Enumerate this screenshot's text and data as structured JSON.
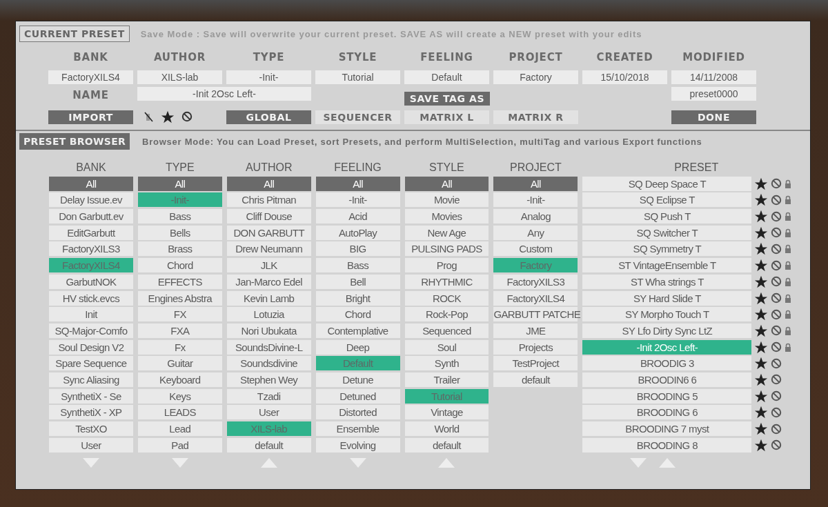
{
  "current_preset": {
    "title": "CURRENT PRESET",
    "save_mode_text": "Save Mode : Save will overwrite your current preset. SAVE AS will create a NEW preset with your edits",
    "fields": [
      {
        "label": "BANK",
        "value": "FactoryXILS4"
      },
      {
        "label": "AUTHOR",
        "value": "XILS-lab"
      },
      {
        "label": "TYPE",
        "value": "-Init-"
      },
      {
        "label": "STYLE",
        "value": "Tutorial"
      },
      {
        "label": "FEELING",
        "value": "Default"
      },
      {
        "label": "PROJECT",
        "value": "Factory"
      },
      {
        "label": "CREATED",
        "value": "15/10/2018"
      },
      {
        "label": "MODIFIED",
        "value": "14/11/2008"
      }
    ],
    "name": {
      "label": "NAME",
      "value": "-Init 2Osc Left-"
    },
    "save_tag_button": "SAVE TAG AS",
    "file_name": "preset0000",
    "import_button": "IMPORT",
    "tabs": [
      {
        "label": "GLOBAL",
        "selected": true
      },
      {
        "label": "SEQUENCER",
        "selected": false
      },
      {
        "label": "MATRIX L",
        "selected": false
      },
      {
        "label": "MATRIX R",
        "selected": false
      }
    ],
    "done_button": "DONE"
  },
  "preset_browser": {
    "title": "PRESET BROWSER",
    "mode_text": "Browser Mode: You can Load Preset, sort Presets, and perform MultiSelection, multiTag and various Export functions",
    "columns": [
      {
        "heading": "BANK",
        "all_label": "All",
        "scroll_down": true,
        "items": [
          {
            "label": "Delay Issue.ev",
            "selected": false
          },
          {
            "label": "Don Garbutt.ev",
            "selected": false
          },
          {
            "label": "EditGarbutt",
            "selected": false
          },
          {
            "label": "FactoryXILS3",
            "selected": false
          },
          {
            "label": "FactoryXILS4",
            "selected": true
          },
          {
            "label": "GarbutNOK",
            "selected": false
          },
          {
            "label": "HV stick.evcs",
            "selected": false
          },
          {
            "label": "Init",
            "selected": false
          },
          {
            "label": "SQ-Major-Comfo",
            "selected": false
          },
          {
            "label": "Soul Design V2",
            "selected": false
          },
          {
            "label": "Spare Sequence",
            "selected": false
          },
          {
            "label": "Sync Aliasing",
            "selected": false
          },
          {
            "label": "SynthetiX - Se",
            "selected": false
          },
          {
            "label": "SynthetiX - XP",
            "selected": false
          },
          {
            "label": "TestXO",
            "selected": false
          },
          {
            "label": "User",
            "selected": false
          }
        ]
      },
      {
        "heading": "TYPE",
        "all_label": "All",
        "scroll_down": true,
        "items": [
          {
            "label": "-Init-",
            "selected": true
          },
          {
            "label": "Bass",
            "selected": false
          },
          {
            "label": "Bells",
            "selected": false
          },
          {
            "label": "Brass",
            "selected": false
          },
          {
            "label": "Chord",
            "selected": false
          },
          {
            "label": "EFFECTS",
            "selected": false
          },
          {
            "label": "Engines Abstra",
            "selected": false
          },
          {
            "label": "FX",
            "selected": false
          },
          {
            "label": "FXA",
            "selected": false
          },
          {
            "label": "Fx",
            "selected": false
          },
          {
            "label": "Guitar",
            "selected": false
          },
          {
            "label": "Keyboard",
            "selected": false
          },
          {
            "label": "Keys",
            "selected": false
          },
          {
            "label": "LEADS",
            "selected": false
          },
          {
            "label": "Lead",
            "selected": false
          },
          {
            "label": "Pad",
            "selected": false
          }
        ]
      },
      {
        "heading": "AUTHOR",
        "all_label": "All",
        "scroll_up": true,
        "items": [
          {
            "label": "Chris Pitman",
            "selected": false
          },
          {
            "label": "Cliff Douse",
            "selected": false
          },
          {
            "label": "DON GARBUTT",
            "selected": false
          },
          {
            "label": "Drew Neumann",
            "selected": false
          },
          {
            "label": "JLK",
            "selected": false
          },
          {
            "label": "Jan-Marco Edel",
            "selected": false
          },
          {
            "label": "Kevin Lamb",
            "selected": false
          },
          {
            "label": "Lotuzia",
            "selected": false
          },
          {
            "label": "Nori Ubukata",
            "selected": false
          },
          {
            "label": "SoundsDivine-L",
            "selected": false
          },
          {
            "label": "Soundsdivine",
            "selected": false
          },
          {
            "label": "Stephen Wey",
            "selected": false
          },
          {
            "label": "Tzadi",
            "selected": false
          },
          {
            "label": "User",
            "selected": false
          },
          {
            "label": "XILS-lab",
            "selected": true
          },
          {
            "label": "default",
            "selected": false
          }
        ]
      },
      {
        "heading": "FEELING",
        "all_label": "All",
        "scroll_down": true,
        "items": [
          {
            "label": "-Init-",
            "selected": false
          },
          {
            "label": "Acid",
            "selected": false
          },
          {
            "label": "AutoPlay",
            "selected": false
          },
          {
            "label": "BIG",
            "selected": false
          },
          {
            "label": "Bass",
            "selected": false
          },
          {
            "label": "Bell",
            "selected": false
          },
          {
            "label": "Bright",
            "selected": false
          },
          {
            "label": "Chord",
            "selected": false
          },
          {
            "label": "Contemplative",
            "selected": false
          },
          {
            "label": "Deep",
            "selected": false
          },
          {
            "label": "Default",
            "selected": true
          },
          {
            "label": "Detune",
            "selected": false
          },
          {
            "label": "Detuned",
            "selected": false
          },
          {
            "label": "Distorted",
            "selected": false
          },
          {
            "label": "Ensemble",
            "selected": false
          },
          {
            "label": "Evolving",
            "selected": false
          }
        ]
      },
      {
        "heading": "STYLE",
        "all_label": "All",
        "scroll_up": true,
        "items": [
          {
            "label": "Movie",
            "selected": false
          },
          {
            "label": "Movies",
            "selected": false
          },
          {
            "label": "New Age",
            "selected": false
          },
          {
            "label": "PULSING PADS",
            "selected": false
          },
          {
            "label": "Prog",
            "selected": false
          },
          {
            "label": "RHYTHMIC",
            "selected": false
          },
          {
            "label": "ROCK",
            "selected": false
          },
          {
            "label": "Rock-Pop",
            "selected": false
          },
          {
            "label": "Sequenced",
            "selected": false
          },
          {
            "label": "Soul",
            "selected": false
          },
          {
            "label": "Synth",
            "selected": false
          },
          {
            "label": "Trailer",
            "selected": false
          },
          {
            "label": "Tutorial",
            "selected": true
          },
          {
            "label": "Vintage",
            "selected": false
          },
          {
            "label": "World",
            "selected": false
          },
          {
            "label": "default",
            "selected": false
          }
        ]
      },
      {
        "heading": "PROJECT",
        "all_label": "All",
        "items": [
          {
            "label": "-Init-",
            "selected": false
          },
          {
            "label": "Analog",
            "selected": false
          },
          {
            "label": "Any",
            "selected": false
          },
          {
            "label": "Custom",
            "selected": false
          },
          {
            "label": "Factory",
            "selected": true
          },
          {
            "label": "FactoryXILS3",
            "selected": false
          },
          {
            "label": "FactoryXILS4",
            "selected": false
          },
          {
            "label": "GARBUTT PATCHE",
            "selected": false
          },
          {
            "label": "JME",
            "selected": false
          },
          {
            "label": "Projects",
            "selected": false
          },
          {
            "label": "TestProject",
            "selected": false
          },
          {
            "label": "default",
            "selected": false
          }
        ]
      }
    ],
    "preset_column": {
      "heading": "PRESET",
      "scroll_down": true,
      "scroll_up": true,
      "items": [
        {
          "name": "SQ Deep Space  T",
          "selected": false,
          "locked": true
        },
        {
          "name": "SQ Eclipse T",
          "selected": false,
          "locked": true
        },
        {
          "name": "SQ Push T",
          "selected": false,
          "locked": true
        },
        {
          "name": "SQ Switcher T",
          "selected": false,
          "locked": true
        },
        {
          "name": "SQ Symmetry T",
          "selected": false,
          "locked": true
        },
        {
          "name": "ST VintageEnsemble T",
          "selected": false,
          "locked": true
        },
        {
          "name": "ST Wha strings T",
          "selected": false,
          "locked": true
        },
        {
          "name": "SY Hard Slide T",
          "selected": false,
          "locked": true
        },
        {
          "name": "SY Morpho Touch T",
          "selected": false,
          "locked": true
        },
        {
          "name": "SY Lfo Dirty Sync LtZ",
          "selected": false,
          "locked": true
        },
        {
          "name": "-Init 2Osc Left-",
          "selected": true,
          "locked": true
        },
        {
          "name": "BROODIG 3",
          "selected": false,
          "locked": false
        },
        {
          "name": "BROODIN6 6",
          "selected": false,
          "locked": false
        },
        {
          "name": "BROODING 5",
          "selected": false,
          "locked": false
        },
        {
          "name": "BROODING 6",
          "selected": false,
          "locked": false
        },
        {
          "name": "BROODING 7 myst",
          "selected": false,
          "locked": false
        },
        {
          "name": "BROODING 8",
          "selected": false,
          "locked": false
        }
      ]
    }
  }
}
